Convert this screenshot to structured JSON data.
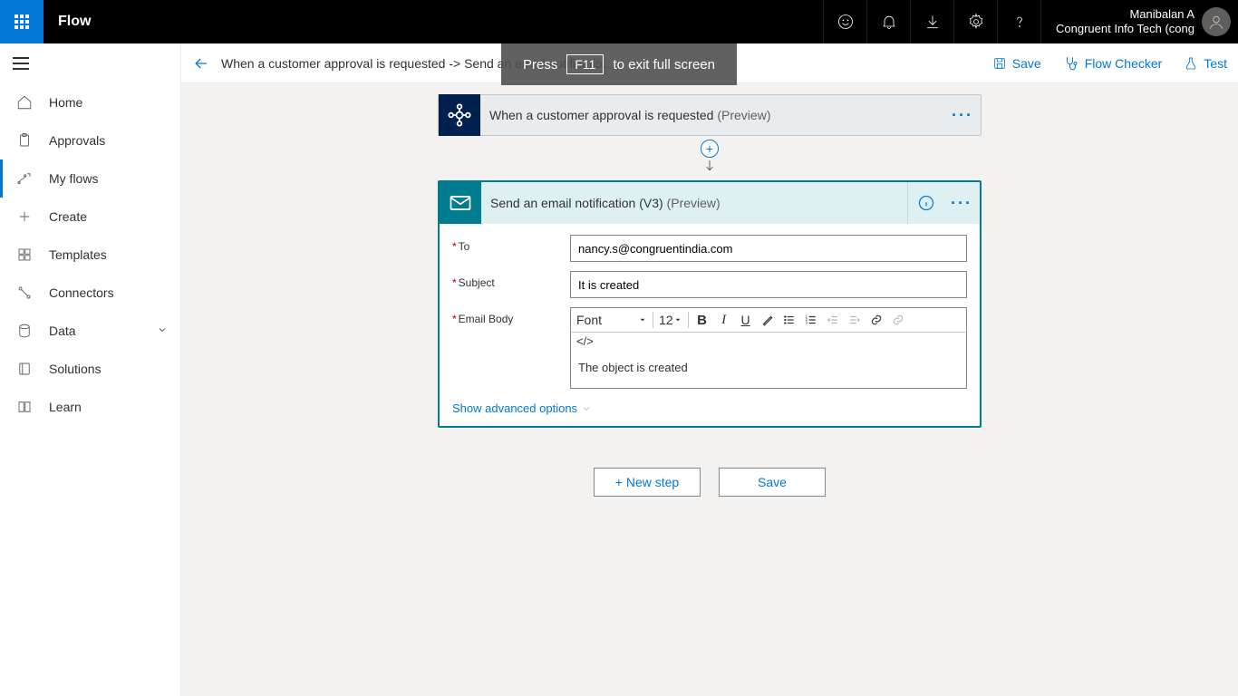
{
  "topbar": {
    "brand": "Flow",
    "user_name": "Manibalan A",
    "user_org": "Congruent Info Tech (cong"
  },
  "fullscreen_toast": {
    "prefix": "Press",
    "key": "F11",
    "suffix": "to exit full screen"
  },
  "sidebar": {
    "items": [
      {
        "label": "Home"
      },
      {
        "label": "Approvals"
      },
      {
        "label": "My flows"
      },
      {
        "label": "Create"
      },
      {
        "label": "Templates"
      },
      {
        "label": "Connectors"
      },
      {
        "label": "Data"
      },
      {
        "label": "Solutions"
      },
      {
        "label": "Learn"
      }
    ]
  },
  "toolbar": {
    "breadcrumb": "When a customer approval is requested -> Send an email notificatio…",
    "save": "Save",
    "flow_checker": "Flow Checker",
    "test": "Test"
  },
  "trigger": {
    "title": "When a customer approval is requested",
    "preview": "(Preview)"
  },
  "action": {
    "title": "Send an email notification (V3)",
    "preview": "(Preview)",
    "fields": {
      "to_label": "To",
      "to_value": "nancy.s@congruentindia.com",
      "subject_label": "Subject",
      "subject_value": "It is created",
      "body_label": "Email Body",
      "body_value": "The object is created"
    },
    "editor": {
      "font_label": "Font",
      "size_label": "12"
    },
    "advanced": "Show advanced options"
  },
  "bottom": {
    "new_step": "+ New step",
    "save": "Save"
  }
}
